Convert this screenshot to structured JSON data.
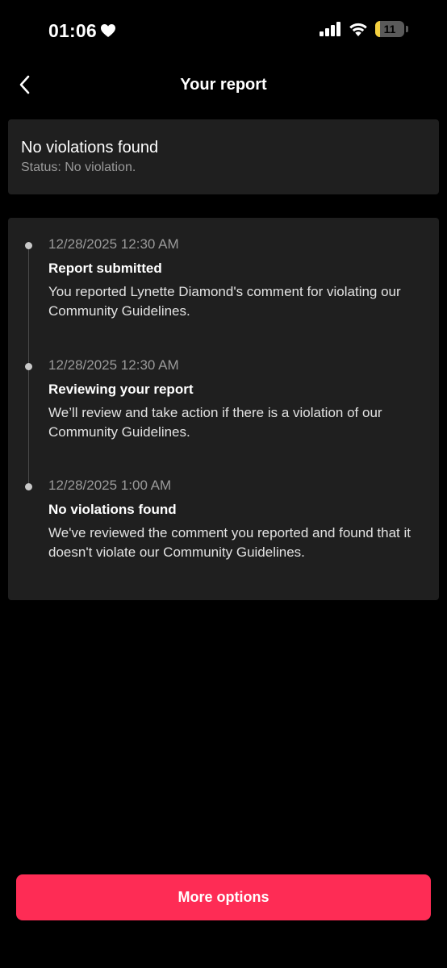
{
  "status_bar": {
    "time": "01:06",
    "battery_level": "11",
    "battery_percent": 11,
    "icons": [
      "heart-icon",
      "signal-icon",
      "wifi-icon",
      "battery-icon"
    ]
  },
  "header": {
    "title": "Your report",
    "back_icon": "chevron-left-icon"
  },
  "summary": {
    "title": "No violations found",
    "status": "Status: No violation."
  },
  "timeline": [
    {
      "time": "12/28/2025 12:30 AM",
      "title": "Report submitted",
      "description": "You reported Lynette Diamond's comment for violating our Community Guidelines."
    },
    {
      "time": "12/28/2025 12:30 AM",
      "title": "Reviewing your report",
      "description": "We’ll review and take action if there is a violation of our Community Guidelines."
    },
    {
      "time": "12/28/2025 1:00 AM",
      "title": "No violations found",
      "description": "We've reviewed the comment you reported and found that it doesn't violate our Community Guidelines."
    }
  ],
  "footer": {
    "more_options_label": "More options"
  },
  "colors": {
    "background": "#000000",
    "card": "#1f1f1f",
    "accent": "#fe2c55",
    "secondary_text": "#9a9a9a",
    "battery_fill": "#f4d03f"
  }
}
